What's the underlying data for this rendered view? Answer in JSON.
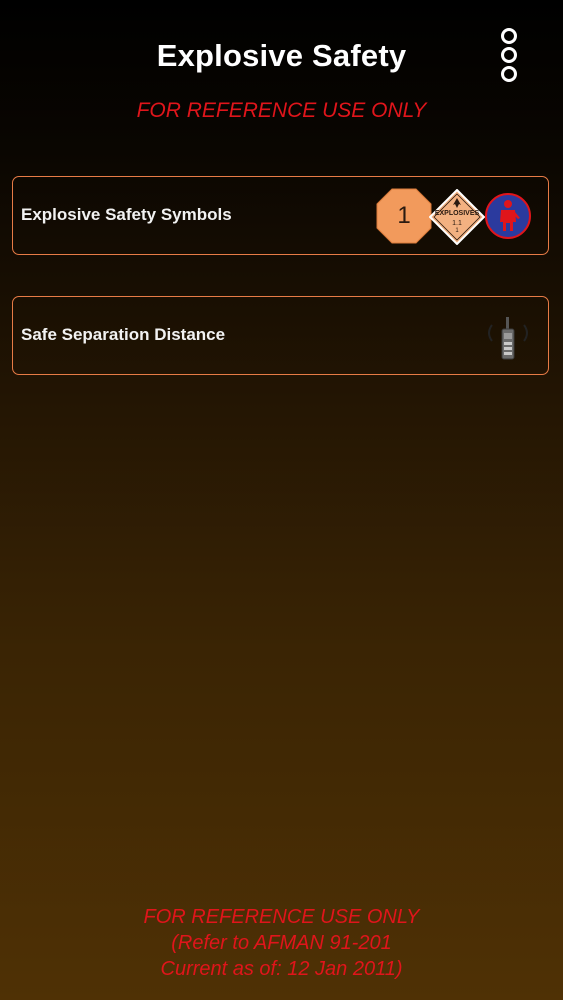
{
  "header": {
    "title": "Explosive Safety",
    "menu_icon": "more-vertical-icon",
    "subtitle": "FOR REFERENCE USE ONLY"
  },
  "menu": {
    "items": [
      {
        "label": "Explosive Safety Symbols",
        "icons": [
          "fire-division-octagon-icon",
          "explosives-placard-icon",
          "protective-clothing-icon"
        ],
        "octagon_number": "1",
        "placard_label": "EXPLOSIVES",
        "placard_division": "1.1",
        "placard_group": "1"
      },
      {
        "label": "Safe Separation Distance",
        "icons": [
          "radio-transmitter-icon"
        ]
      }
    ]
  },
  "footer": {
    "line1": "FOR REFERENCE USE ONLY",
    "line2": "(Refer to AFMAN 91-201",
    "line3": "Current as of: 12 Jan 2011)"
  },
  "colors": {
    "accent_red": "#e0151b",
    "row_border": "#e77b46",
    "octagon_fill": "#f29a5c",
    "placard_fill": "#f3b181",
    "ppe_fill": "#2b3a9e",
    "ppe_figure": "#e0151b"
  }
}
